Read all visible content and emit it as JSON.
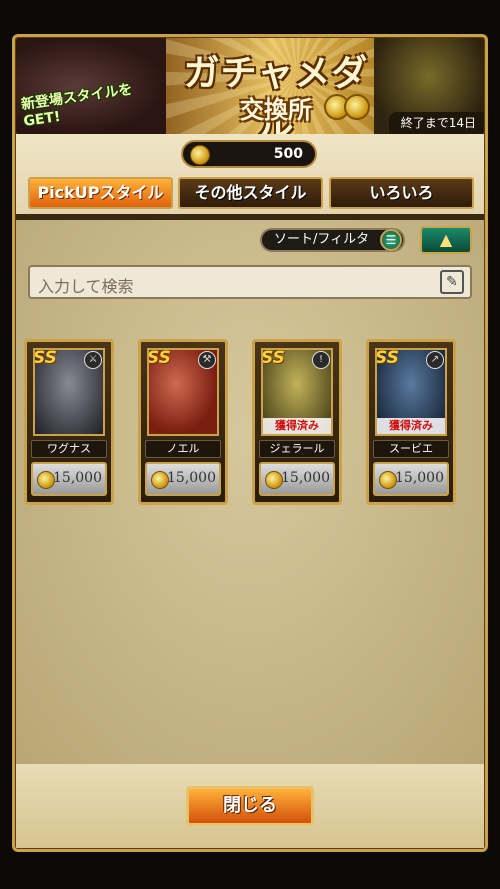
{
  "banner": {
    "title": "ガチャメダル",
    "subtitle": "交換所",
    "promo": "新登場スタイルをGET!",
    "period": "終了まで14日"
  },
  "medals": {
    "count": "500"
  },
  "tabs": [
    {
      "label": "PickUPスタイル",
      "active": true
    },
    {
      "label": "その他スタイル",
      "active": false
    },
    {
      "label": "いろいろ",
      "active": false
    }
  ],
  "sort_filter": {
    "label": "ソート/フィルタ"
  },
  "search": {
    "placeholder": "入力して検索"
  },
  "cards": [
    {
      "name": "ワグナス",
      "price": "15,000",
      "rank": "SS",
      "owned": "",
      "bg": "#3a3a44"
    },
    {
      "name": "ノエル",
      "price": "15,000",
      "rank": "SS",
      "owned": "",
      "bg": "#a03a2a"
    },
    {
      "name": "ジェラール",
      "price": "15,000",
      "rank": "SS",
      "owned": "獲得済み",
      "bg": "#7a7a2a"
    },
    {
      "name": "スービエ",
      "price": "15,000",
      "rank": "SS",
      "owned": "獲得済み",
      "bg": "#1e3a5a"
    }
  ],
  "footer": {
    "close_label": "閉じる"
  }
}
